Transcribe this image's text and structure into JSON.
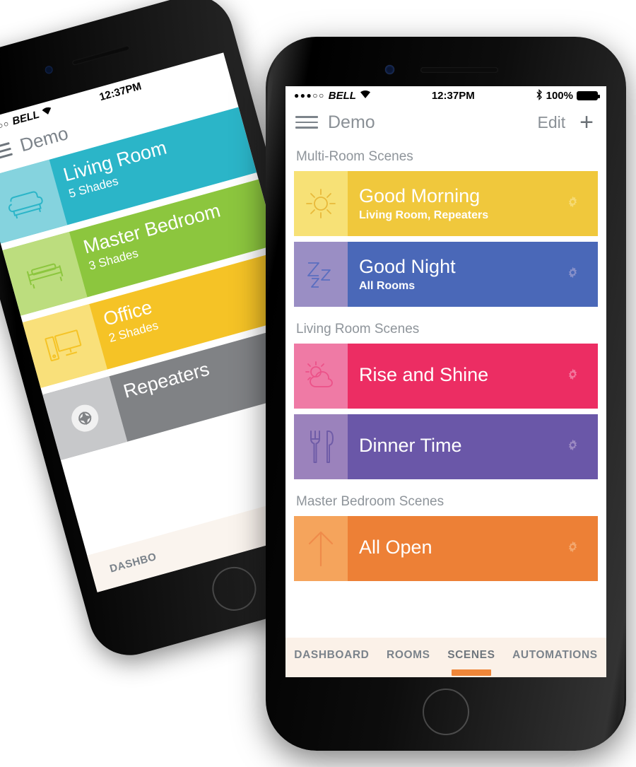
{
  "app": {
    "status_bar": {
      "signal_dots": "●●●○○",
      "carrier": "BELL",
      "wifi_icon": "wifi-icon",
      "time": "12:37PM",
      "bluetooth_icon": "bluetooth-icon",
      "battery_percent": "100%",
      "battery_icon": "battery-full-icon"
    },
    "navbar": {
      "menu_icon": "hamburger-menu-icon",
      "title": "Demo",
      "edit_label": "Edit",
      "add_label": "+"
    },
    "sections": [
      {
        "header": "Multi-Room Scenes",
        "scenes": [
          {
            "name": "Good Morning",
            "subtitle": "Living Room, Repeaters",
            "icon": "sun-icon",
            "color": "#f0c83c",
            "icon_panel_color": "#f7e176",
            "icon_stroke": "#e8b93a",
            "gear_color": "#f8e9a0"
          },
          {
            "name": "Good Night",
            "subtitle": "All Rooms",
            "icon": "zzz-sleep-icon",
            "color": "#4a68b8",
            "icon_panel_color": "#9a8ec4",
            "icon_stroke": "#5a6ec0",
            "gear_color": "#b9b2d8"
          }
        ]
      },
      {
        "header": "Living Room Scenes",
        "scenes": [
          {
            "name": "Rise and Shine",
            "subtitle": "",
            "icon": "sun-cloud-icon",
            "color": "#ec2d63",
            "icon_panel_color": "#ef7aa5",
            "icon_stroke": "#ec5289",
            "gear_color": "#f7a9c6"
          },
          {
            "name": "Dinner Time",
            "subtitle": "",
            "icon": "fork-knife-icon",
            "color": "#6a57a8",
            "icon_panel_color": "#9b82bc",
            "icon_stroke": "#6f5ca7",
            "gear_color": "#bcaad3"
          }
        ]
      },
      {
        "header": "Master Bedroom Scenes",
        "scenes": [
          {
            "name": "All Open",
            "subtitle": "",
            "icon": "arrow-up-icon",
            "color": "#ed8036",
            "icon_panel_color": "#f5a košice",
            "icon_stroke": "#ef8b4a",
            "gear_color": "#f7c294"
          }
        ]
      }
    ],
    "tabs": [
      {
        "label": "DASHBOARD",
        "active": false
      },
      {
        "label": "ROOMS",
        "active": false
      },
      {
        "label": "SCENES",
        "active": true
      },
      {
        "label": "AUTOMATIONS",
        "active": false
      }
    ],
    "tabbar_accent": "#ef8639"
  },
  "background_phone": {
    "status_bar": {
      "signal_dots": "●●●○○",
      "carrier": "BELL",
      "time": "12:37PM"
    },
    "navbar": {
      "menu_icon": "hamburger-menu-icon",
      "title": "Demo"
    },
    "rooms": [
      {
        "name": "Living Room",
        "subtitle": "5 Shades",
        "icon": "armchair-icon",
        "color": "#2bb5c8",
        "icon_panel_color": "#85d3de"
      },
      {
        "name": "Master Bedroom",
        "subtitle": "3 Shades",
        "icon": "bed-icon",
        "color": "#8cc63e",
        "icon_panel_color": "#bcdd7e"
      },
      {
        "name": "Office",
        "subtitle": "2 Shades",
        "icon": "computer-icon",
        "color": "#f5c326",
        "icon_panel_color": "#f9e07a"
      },
      {
        "name": "Repeaters",
        "subtitle": "",
        "icon": "repeater-icon",
        "color": "#808285",
        "icon_panel_color": "#c7c8ca"
      }
    ],
    "tab_label": "DASHBO"
  }
}
